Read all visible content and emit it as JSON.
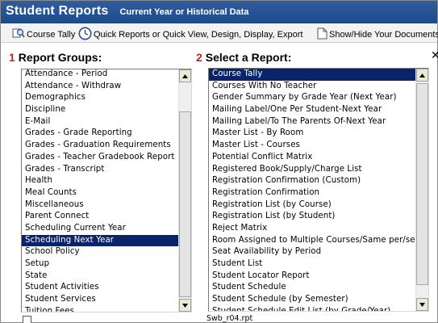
{
  "titlebar": {
    "title": "Student Reports",
    "subtitle": "Current Year or Historical Data"
  },
  "toolbar": {
    "course_tally": "Course Tally",
    "quick_reports": "Quick Reports or Quick View, Design, Display, Export",
    "show_hide_docs": "Show/Hide Your Documents"
  },
  "report_groups": {
    "number": "1",
    "heading": "Report Groups:",
    "selected": "Scheduling Next Year",
    "items": [
      "Attendance - Period",
      "Attendance - Withdraw",
      "Demographics",
      "Discipline",
      "E-Mail",
      "Grades - Grade Reporting",
      "Grades - Graduation Requirements",
      "Grades - Teacher Gradebook Report",
      "Grades - Transcript",
      "Health",
      "Meal Counts",
      "Miscellaneous",
      "Parent Connect",
      "Scheduling Current Year",
      "Scheduling Next Year",
      "School Policy",
      "Setup",
      "State",
      "Student Activities",
      "Student Services",
      "Tuition Fees"
    ]
  },
  "select_report": {
    "number": "2",
    "heading": "Select a Report:",
    "selected": "Course Tally",
    "items": [
      "Course Tally",
      "Courses With No Teacher",
      "Gender Summary by Grade Year (Next Year)",
      "Mailing Label/One Per Student-Next Year",
      "Mailing Label/To The Parents Of-Next Year",
      "Master List - By Room",
      "Master List - Courses",
      "Potential Conflict Matrix",
      "Registered Book/Supply/Charge List",
      "Registration Confirmation (Custom)",
      "Registration Confirmation",
      "Registration List (by Course)",
      "Registration List (by Student)",
      "Reject Matrix",
      "Room Assigned to Multiple Courses/Same per/se",
      "Seat Availability by Period",
      "Student List",
      "Student Locator Report",
      "Student Schedule",
      "Student Schedule (by Semester)",
      "Student Schedule Edit List (by Grade/Year)"
    ]
  },
  "status": {
    "filename": "Swb_r04.rpt"
  },
  "colors": {
    "title_bar": "#1d4a8a",
    "selection": "#0a246a",
    "step_number": "#c0281b"
  }
}
